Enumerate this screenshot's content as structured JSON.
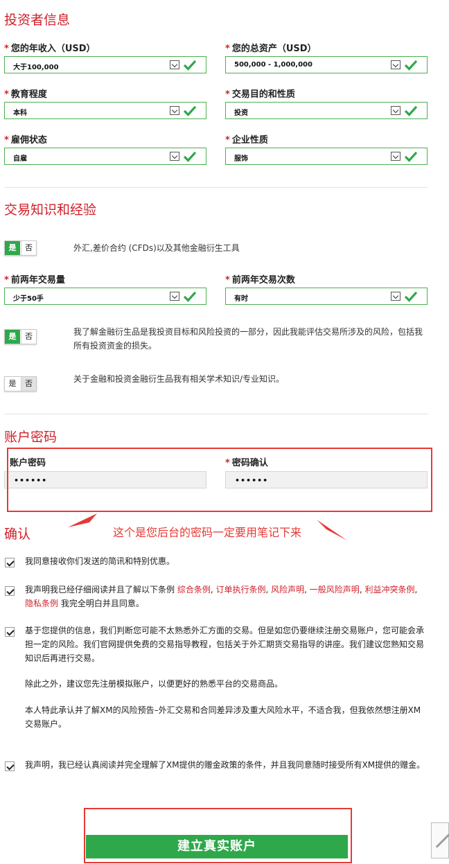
{
  "investor": {
    "title": "投资者信息",
    "fields": [
      {
        "label": "您的年收入（USD）",
        "value": "大于100,000"
      },
      {
        "label": "您的总资产（USD）",
        "value": "500,000 - 1,000,000"
      },
      {
        "label": "教育程度",
        "value": "本科"
      },
      {
        "label": "交易目的和性质",
        "value": "投资"
      },
      {
        "label": "雇佣状态",
        "value": "自雇"
      },
      {
        "label": "企业性质",
        "value": "服饰"
      }
    ]
  },
  "knowledge": {
    "title": "交易知识和经验",
    "yes": "是",
    "no": "否",
    "q1": "外汇,差价合约 (CFDs)以及其他金融衍生工具",
    "fields": [
      {
        "label": "前两年交易量",
        "value": "少于50手"
      },
      {
        "label": "前两年交易次数",
        "value": "有时"
      }
    ],
    "q2": "我了解金融衍生品是我投资目标和风险投资的一部分，因此我能评估交易所涉及的风险，包括我所有投资资金的损失。",
    "q3": "关于金融和投资金融衍生品我有相关学术知识/专业知识。"
  },
  "password": {
    "title": "账户密码",
    "label": "账户密码",
    "confirm_label": "密码确认",
    "value": "••••••",
    "confirm_value": "••••••"
  },
  "annotation": "这个是您后台的密码一定要用笔记下来",
  "confirm": {
    "title": "确认",
    "item1": "我同意接收你们发送的简讯和特别优惠。",
    "item2_before": "我声明我已经仔细阅读并且了解以下条例 ",
    "links": [
      "综合条例",
      "订单执行条例",
      "风险声明",
      "一般风险声明",
      "利益冲突条例",
      "隐私条例"
    ],
    "item2_after": " 我完全明白并且同意。",
    "item3_p1": "基于您提供的信息，我们判断您可能不太熟悉外汇方面的交易。但是如您仍要继续注册交易账户，您可能会承担一定的风险。我们官网提供免费的交易指导教程，包括关于外汇期货交易指导的讲座。我们建议您熟知交易知识后再进行交易。",
    "item3_p2": "除此之外，建议您先注册模拟账户，以便更好的熟悉平台的交易商品。",
    "item3_p3": "本人特此承认并了解XM的风险预告–外汇交易和合同差异涉及重大风险水平，不适合我，但我依然想注册XM交易账户。",
    "item4": "我声明，我已经认真阅读并完全理解了XM提供的赠金政策的条件，并且我同意随时接受所有XM提供的赠金。"
  },
  "submit_label": "建立真实账户",
  "colors": {
    "accent_red": "#d0212a",
    "green": "#2ea84a",
    "annotation_red": "#e53935"
  }
}
